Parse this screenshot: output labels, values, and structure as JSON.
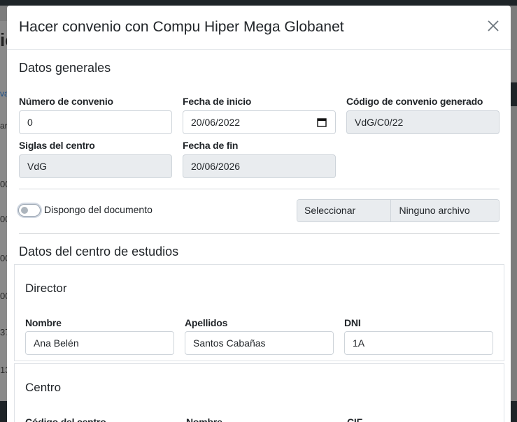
{
  "background": {
    "fragments": [
      "ic",
      "va",
      "ar",
      "00",
      "00",
      "00",
      "00",
      "37",
      "13"
    ]
  },
  "modal": {
    "title": "Hacer convenio con Compu Hiper Mega Globanet",
    "close_icon": "close-icon"
  },
  "general": {
    "section_title": "Datos generales",
    "numero_label": "Número de convenio",
    "numero_value": "0",
    "fecha_inicio_label": "Fecha de inicio",
    "fecha_inicio_value": "20/06/2022",
    "codigo_label": "Código de convenio generado",
    "codigo_value": "VdG/C0/22",
    "siglas_label": "Siglas del centro",
    "siglas_value": "VdG",
    "fecha_fin_label": "Fecha de fin",
    "fecha_fin_value": "20/06/2026",
    "toggle_label": "Dispongo del documento",
    "toggle_on": false,
    "file_button": "Seleccionar archivo",
    "file_name": "Ninguno archivo selec."
  },
  "centro_estudios": {
    "section_title": "Datos del centro de estudios",
    "director": {
      "title": "Director",
      "nombre_label": "Nombre",
      "nombre_value": "Ana Belén",
      "apellidos_label": "Apellidos",
      "apellidos_value": "Santos Cabañas",
      "dni_label": "DNI",
      "dni_value": "1A"
    },
    "centro": {
      "title": "Centro",
      "codigo_label": "Código del centro",
      "nombre_label": "Nombre",
      "cif_label": "CIF"
    }
  },
  "colors": {
    "readonly_bg": "#e9ecef",
    "border": "#ced4da",
    "text": "#212529"
  }
}
